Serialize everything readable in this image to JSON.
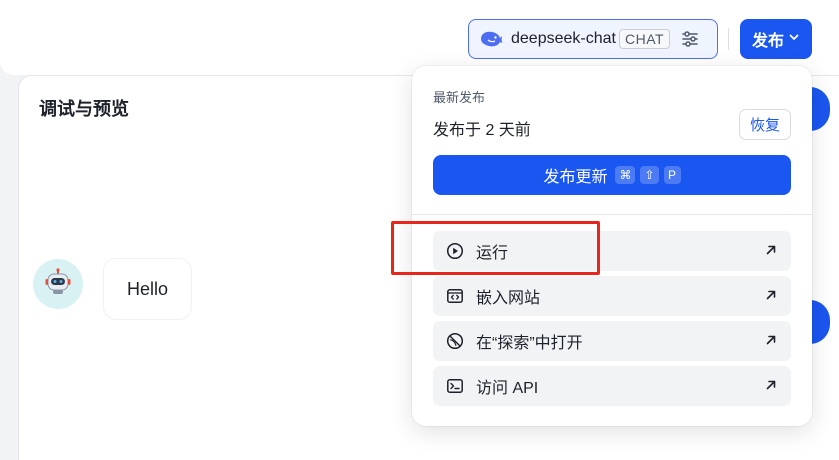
{
  "header": {
    "model_chip": {
      "model_name": "deepseek-chat",
      "tag": "CHAT",
      "icon": "whale-icon",
      "settings_icon": "sliders-icon"
    },
    "publish_button": {
      "label": "发布",
      "icon": "chevron-down-icon"
    }
  },
  "panel": {
    "title": "调试与预览",
    "message": {
      "avatar_icon": "robot-icon",
      "text": "Hello"
    }
  },
  "publish_menu": {
    "section_label": "最新发布",
    "published_time": "发布于 2 天前",
    "restore_label": "恢复",
    "update_button": {
      "label": "发布更新",
      "shortcut_keys": [
        "⌘",
        "⇧",
        "P"
      ]
    },
    "actions": [
      {
        "label": "运行",
        "icon": "play-circle-icon",
        "arrow": "external-arrow-icon"
      },
      {
        "label": "嵌入网站",
        "icon": "embed-code-icon",
        "arrow": "external-arrow-icon"
      },
      {
        "label": "在“探索”中打开",
        "icon": "explore-icon",
        "arrow": "external-arrow-icon"
      },
      {
        "label": "访问 API",
        "icon": "terminal-icon",
        "arrow": "external-arrow-icon"
      }
    ]
  },
  "colors": {
    "accent": "#1a56f0",
    "highlight": "#e8261c",
    "avatar_bg": "#d8f2f4"
  }
}
